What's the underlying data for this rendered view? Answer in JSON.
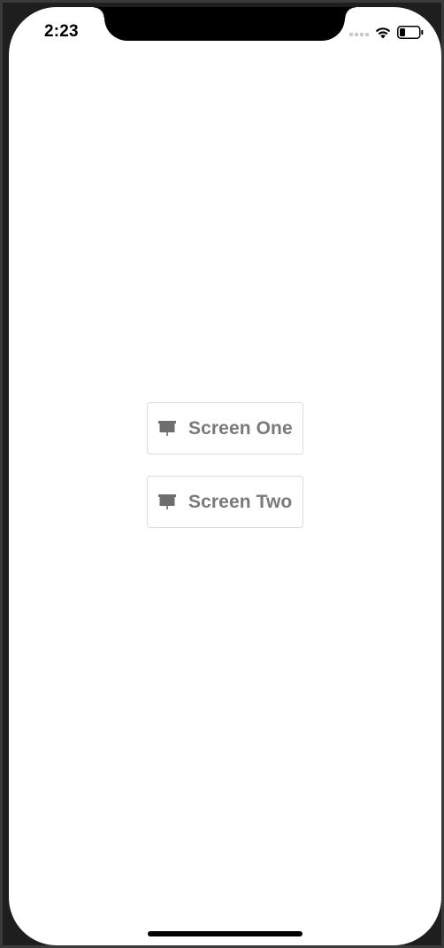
{
  "status_bar": {
    "time": "2:23",
    "icons": [
      "signal-dots-icon",
      "wifi-icon",
      "battery-icon"
    ]
  },
  "buttons": [
    {
      "label": "Screen One",
      "icon": "presentation-icon"
    },
    {
      "label": "Screen Two",
      "icon": "presentation-icon"
    }
  ],
  "colors": {
    "button_text": "#7a7a7a",
    "button_border": "#dcdcdc",
    "icon": "#6e6e6e",
    "background": "#ffffff"
  }
}
